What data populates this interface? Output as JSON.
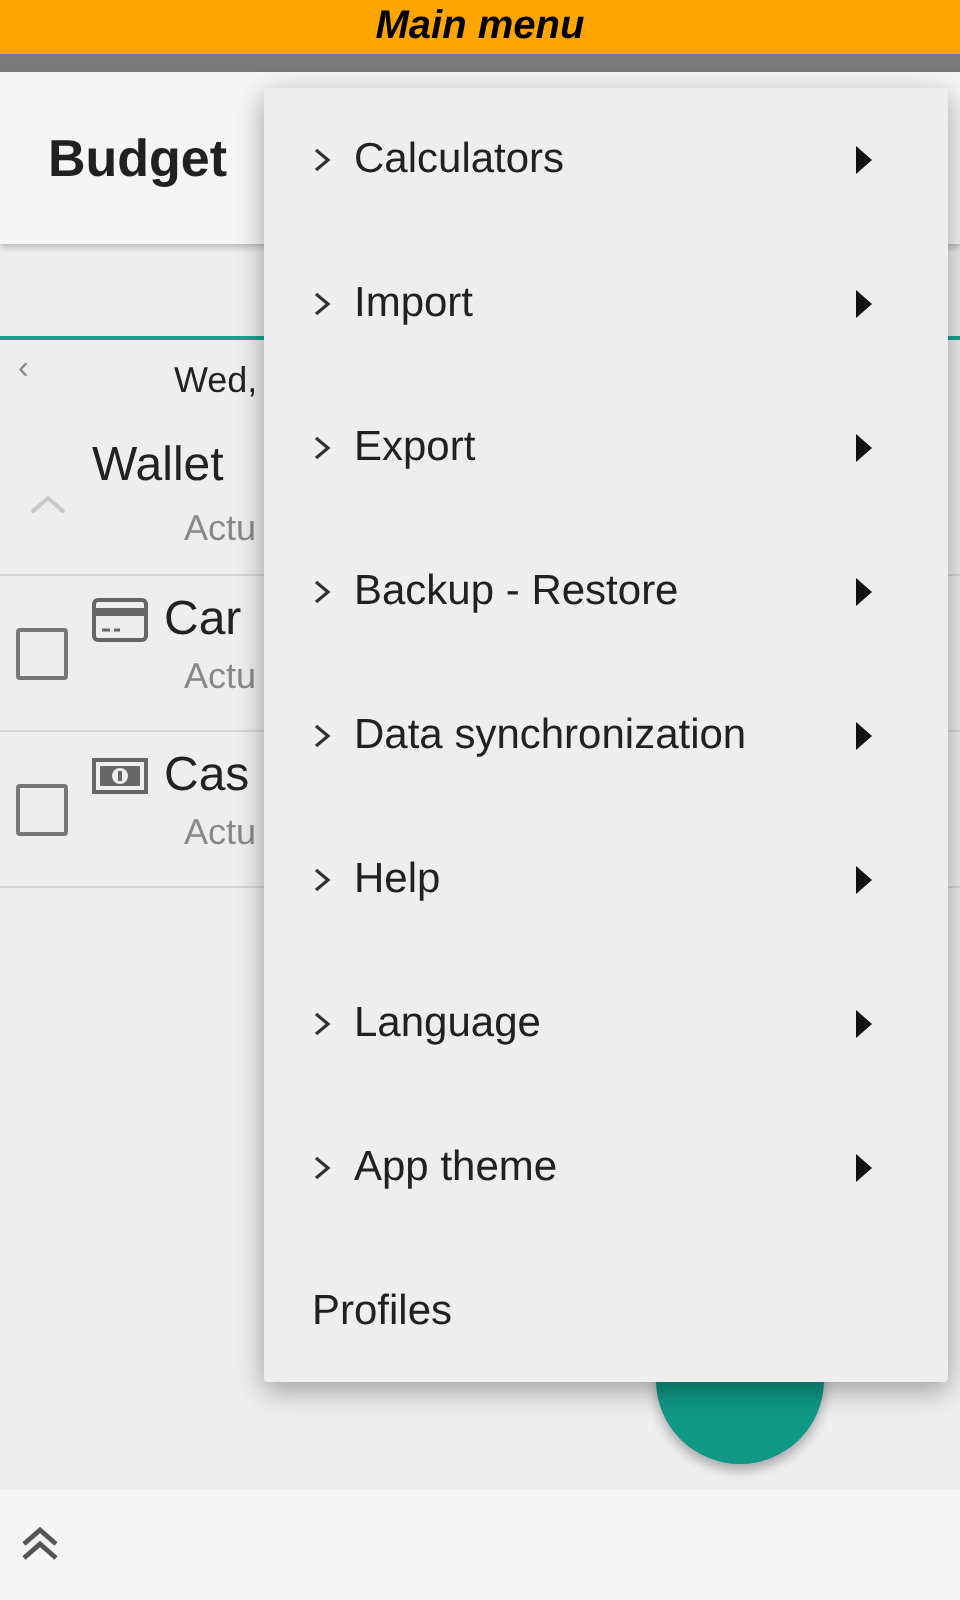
{
  "banner": {
    "title": "Main menu"
  },
  "app_bar": {
    "title": "Budget"
  },
  "date_row": {
    "prev": "‹",
    "date": "Wed,"
  },
  "accounts": [
    {
      "kind": "group",
      "name": "Wallet",
      "subtitle": "Actu",
      "expanded": true
    },
    {
      "kind": "card",
      "name": "Car",
      "subtitle": "Actu",
      "checked": false
    },
    {
      "kind": "cash",
      "name": "Cas",
      "subtitle": "Actu",
      "checked": false
    }
  ],
  "menu": {
    "items": [
      {
        "label": "Calculators",
        "has_submenu": true
      },
      {
        "label": "Import",
        "has_submenu": true
      },
      {
        "label": "Export",
        "has_submenu": true
      },
      {
        "label": "Backup - Restore",
        "has_submenu": true
      },
      {
        "label": "Data synchronization",
        "has_submenu": true
      },
      {
        "label": "Help",
        "has_submenu": true
      },
      {
        "label": "Language",
        "has_submenu": true
      },
      {
        "label": "App theme",
        "has_submenu": true
      },
      {
        "label": "Profiles",
        "has_submenu": false
      }
    ]
  }
}
